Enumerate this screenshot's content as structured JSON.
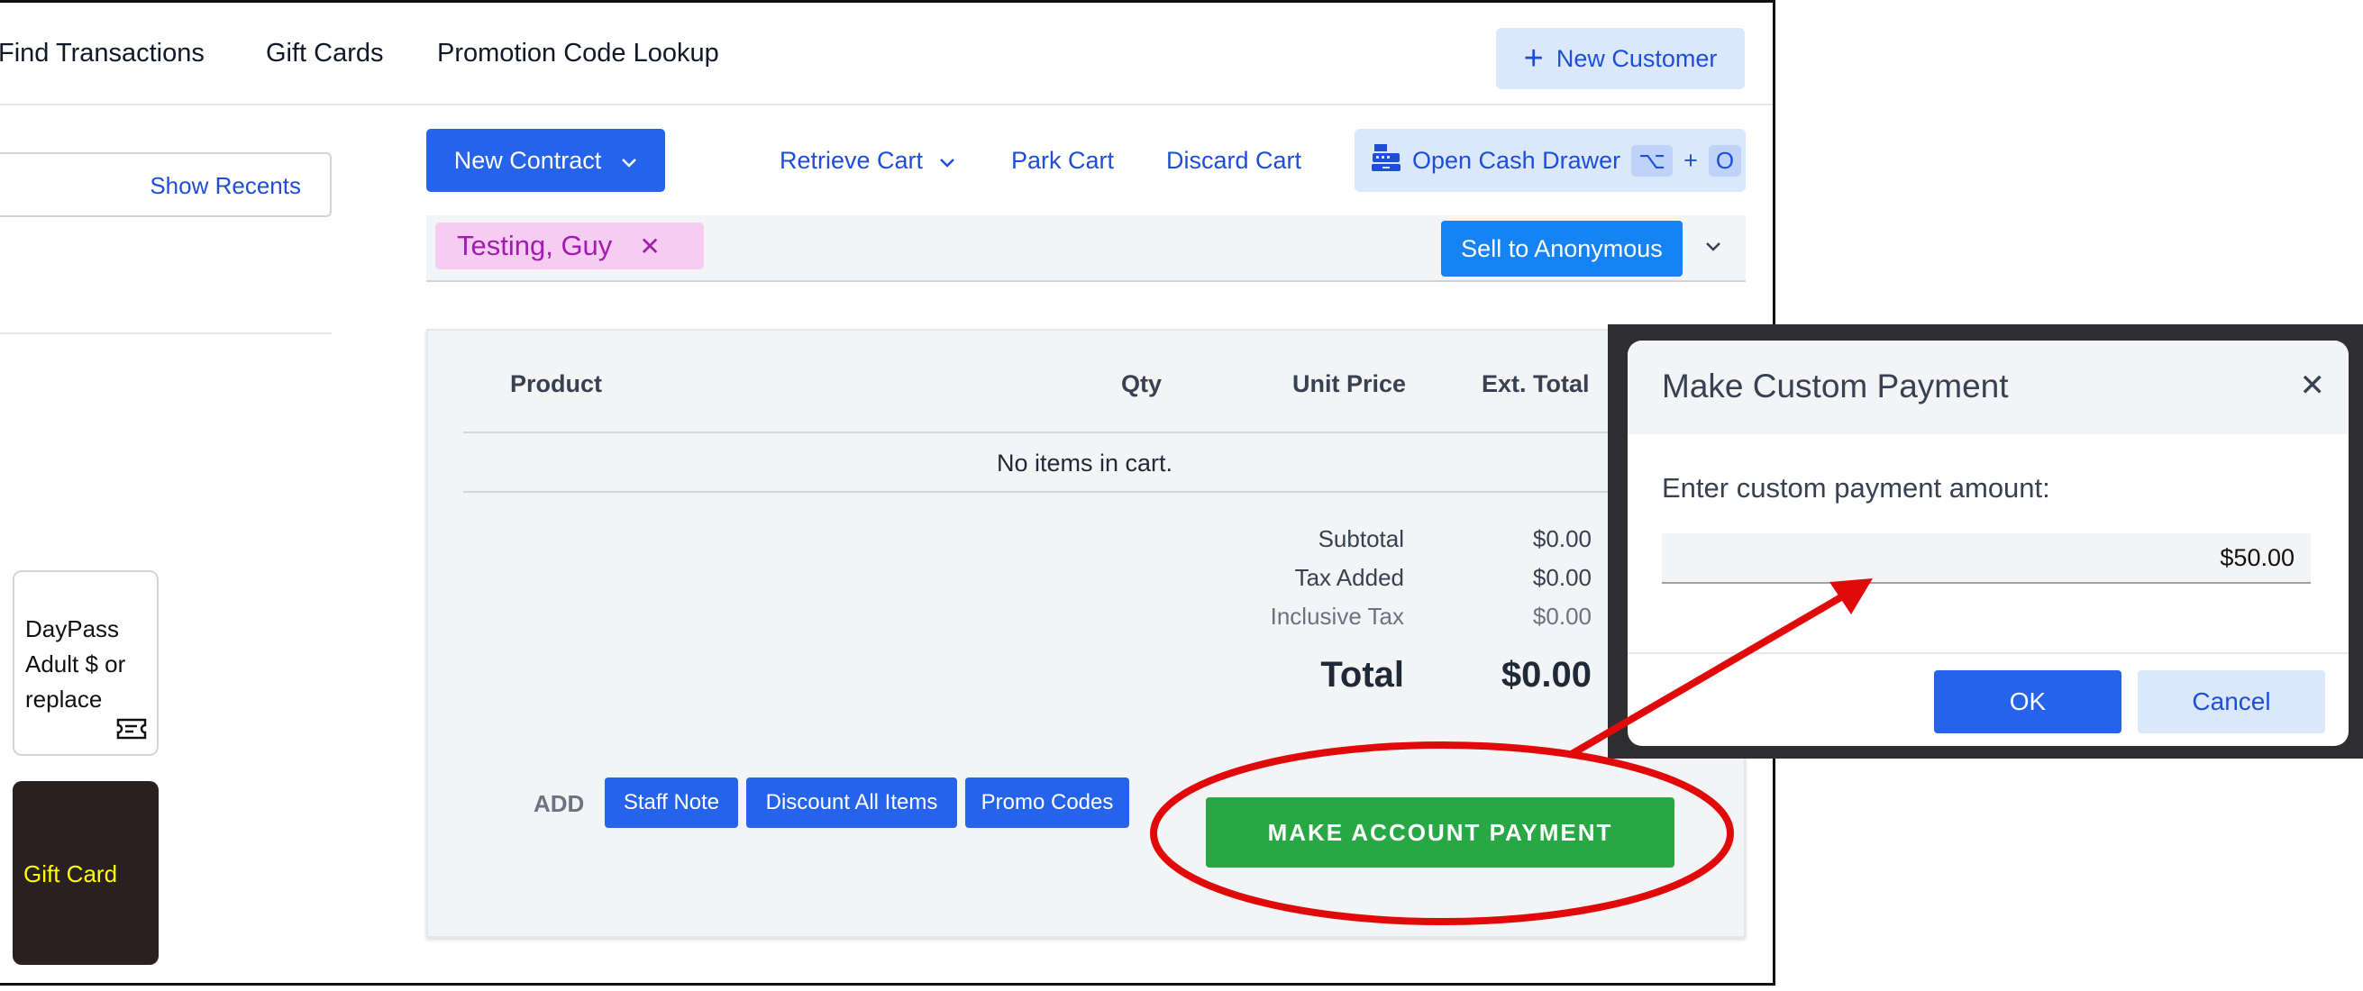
{
  "topnav": {
    "links": [
      "Find Transactions",
      "Gift Cards",
      "Promotion Code Lookup"
    ],
    "new_customer_label": "New Customer"
  },
  "left": {
    "show_recents_label": "Show Recents",
    "tiles": [
      {
        "label": "DayPass Adult $ or replace",
        "icon": "ticket-icon"
      },
      {
        "label": "Gift Card"
      }
    ]
  },
  "actions": {
    "new_contract_label": "New Contract",
    "retrieve_cart_label": "Retrieve Cart",
    "park_cart_label": "Park Cart",
    "discard_cart_label": "Discard Cart",
    "open_cash_drawer_label": "Open Cash Drawer",
    "shortcut_key1": "⌥",
    "shortcut_plus": "+",
    "shortcut_key2": "O"
  },
  "customer": {
    "name": "Testing, Guy",
    "sell_anonymous_label": "Sell to Anonymous"
  },
  "cart": {
    "columns": [
      "Product",
      "Qty",
      "Unit Price",
      "Ext. Total"
    ],
    "empty_message": "No items in cart.",
    "totals": [
      {
        "label": "Subtotal",
        "value": "$0.00"
      },
      {
        "label": "Tax Added",
        "value": "$0.00"
      },
      {
        "label": "Inclusive Tax",
        "value": "$0.00"
      },
      {
        "label": "Total",
        "value": "$0.00"
      }
    ],
    "add_label": "ADD",
    "add_buttons": [
      "Staff Note",
      "Discount All Items",
      "Promo Codes"
    ],
    "make_payment_label": "MAKE ACCOUNT PAYMENT"
  },
  "modal": {
    "title": "Make Custom Payment",
    "prompt": "Enter custom payment amount:",
    "amount_value": "$50.00",
    "ok_label": "OK",
    "cancel_label": "Cancel"
  },
  "colors": {
    "primary": "#2563eb",
    "success": "#28a745",
    "annotation": "#e10a0a",
    "tag_bg": "#f6ccf3"
  }
}
